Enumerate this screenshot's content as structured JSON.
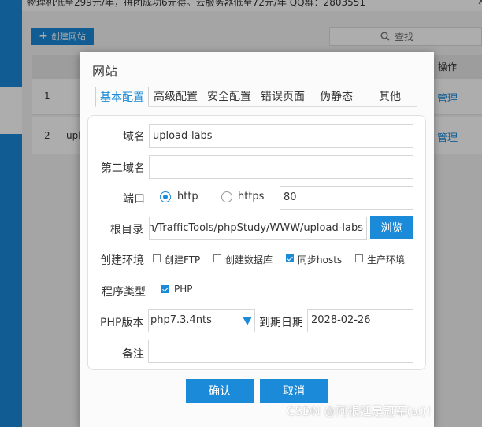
{
  "background": {
    "notice": "物理机低至299元/年，拼团成功6元得。云服务器低至72元/年 QQ群：2803551",
    "close_icon": "close-icon",
    "create_button": "创建网站",
    "search_label": "查找",
    "operation_header": "操作",
    "rows": [
      {
        "num": "1",
        "site": "",
        "action": "管理"
      },
      {
        "num": "2",
        "site": "upl",
        "action": "管理"
      }
    ]
  },
  "dialog": {
    "title": "网站",
    "tabs": [
      "基本配置",
      "高级配置",
      "安全配置",
      "错误页面",
      "伪静态",
      "其他"
    ],
    "active_tab": 0,
    "form": {
      "domain_label": "域名",
      "domain_value": "upload-labs",
      "second_domain_label": "第二域名",
      "second_domain_value": "",
      "port_label": "端口",
      "protocol_http": "http",
      "protocol_https": "https",
      "selected_protocol": "http",
      "port_value": "80",
      "root_label": "根目录",
      "root_value": "D:/Security/Penetration/TrafficTools/phpStudy/WWW/upload-labs",
      "browse_button": "浏览",
      "env_label": "创建环境",
      "env_options": [
        {
          "label": "创建FTP",
          "checked": false
        },
        {
          "label": "创建数据库",
          "checked": false
        },
        {
          "label": "同步hosts",
          "checked": true
        },
        {
          "label": "生产环境",
          "checked": false
        }
      ],
      "program_type_label": "程序类型",
      "program_type_option": {
        "label": "PHP",
        "checked": true
      },
      "php_version_label": "PHP版本",
      "php_version_value": "php7.3.4nts",
      "expire_label": "到期日期",
      "expire_value": "2028-02-26",
      "remark_label": "备注",
      "remark_value": ""
    },
    "confirm_button": "确认",
    "cancel_button": "取消"
  },
  "watermark": "CSDN @阿根廷是冠军(ω)！",
  "colors": {
    "accent": "#1a8ad9",
    "overlay": "rgba(0,0,0,0.32)"
  }
}
